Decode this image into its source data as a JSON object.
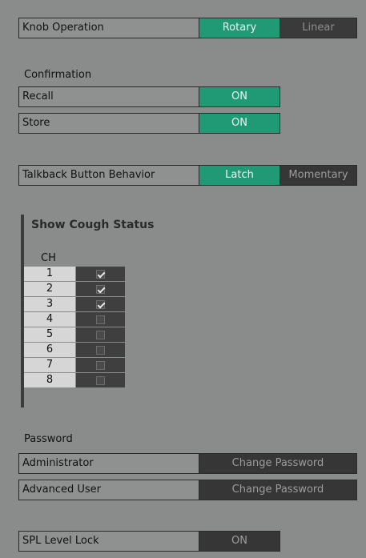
{
  "knob_operation": {
    "label": "Knob Operation",
    "option_rotary": "Rotary",
    "option_linear": "Linear",
    "selected": "Rotary"
  },
  "confirmation": {
    "heading": "Confirmation",
    "recall_label": "Recall",
    "recall_value": "ON",
    "store_label": "Store",
    "store_value": "ON"
  },
  "talkback": {
    "label": "Talkback Button Behavior",
    "option_latch": "Latch",
    "option_momentary": "Momentary",
    "selected": "Latch"
  },
  "cough_status": {
    "title": "Show Cough Status",
    "ch_header": "CH",
    "channels": [
      {
        "ch": "1",
        "checked": true
      },
      {
        "ch": "2",
        "checked": true
      },
      {
        "ch": "3",
        "checked": true
      },
      {
        "ch": "4",
        "checked": false
      },
      {
        "ch": "5",
        "checked": false
      },
      {
        "ch": "6",
        "checked": false
      },
      {
        "ch": "7",
        "checked": false
      },
      {
        "ch": "8",
        "checked": false
      }
    ]
  },
  "password": {
    "heading": "Password",
    "administrator_label": "Administrator",
    "administrator_button": "Change Password",
    "advanced_user_label": "Advanced User",
    "advanced_user_button": "Change Password"
  },
  "spl_level_lock": {
    "label": "SPL Level Lock",
    "value": "ON"
  },
  "colors": {
    "background": "#8a8c8c",
    "active_green": "#1f9a74",
    "inactive_dark": "#3a3a3a"
  }
}
